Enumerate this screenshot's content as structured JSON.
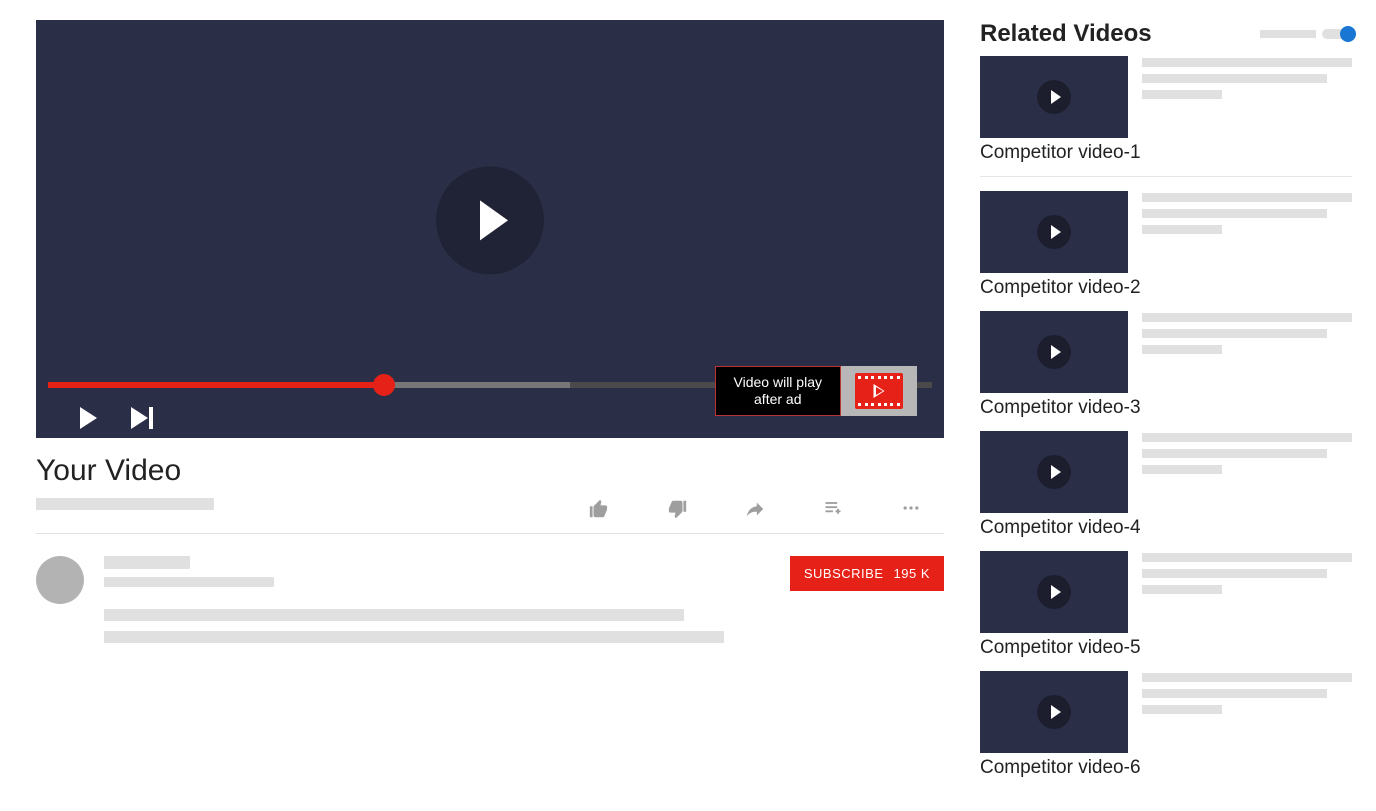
{
  "video": {
    "title": "Your Video",
    "adNotice": {
      "line1": "Video will play",
      "line2": "after ad"
    },
    "progressPercent": 38,
    "bufferedPercent": 59
  },
  "subscribe": {
    "label": "SUBSCRIBE",
    "count": "195 K"
  },
  "sidebar": {
    "title": "Related Videos",
    "autoplayOn": true,
    "items": [
      {
        "caption": "Competitor video-1"
      },
      {
        "caption": "Competitor video-2"
      },
      {
        "caption": "Competitor video-3"
      },
      {
        "caption": "Competitor video-4"
      },
      {
        "caption": "Competitor video-5"
      },
      {
        "caption": "Competitor video-6"
      }
    ]
  }
}
